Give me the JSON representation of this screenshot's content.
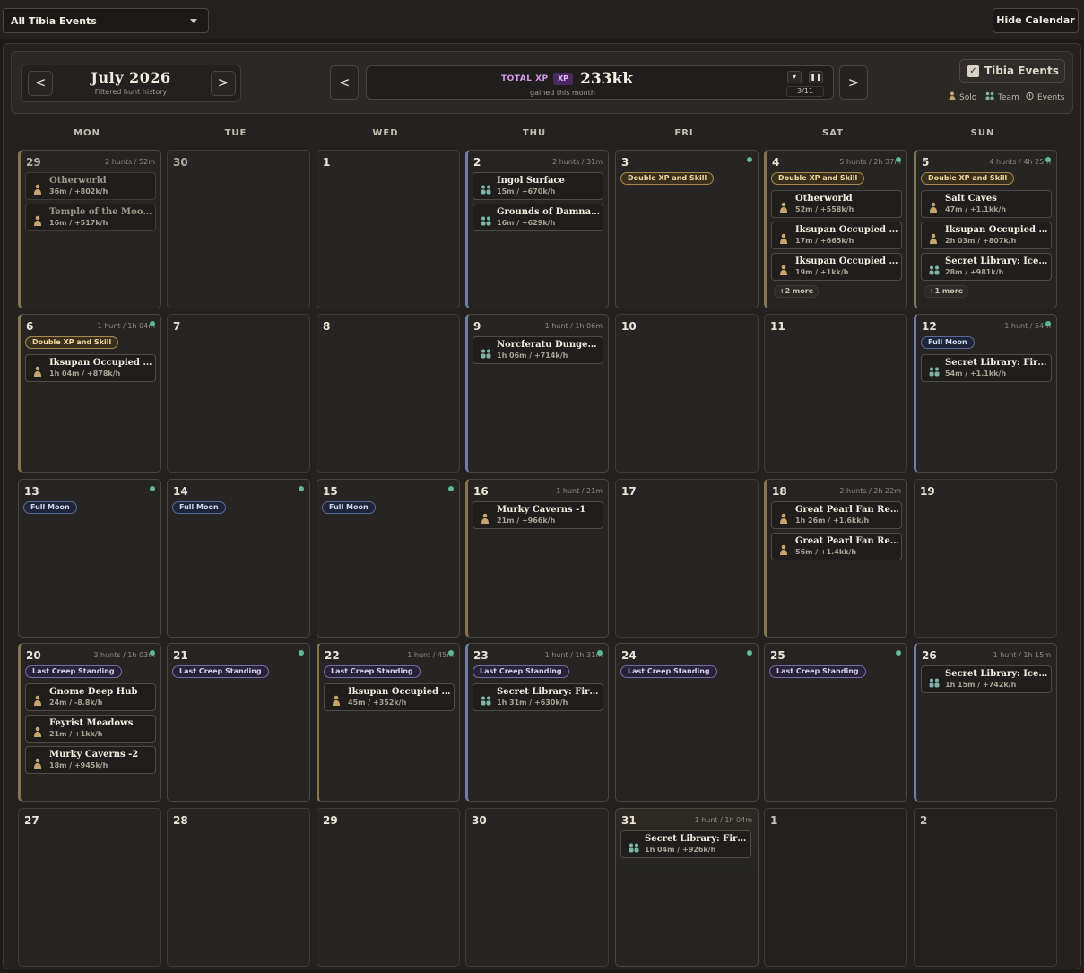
{
  "topbar": {
    "filter_value": "All Tibia Events",
    "hide_button": "Hide Calendar"
  },
  "header": {
    "prev": "<",
    "next": ">",
    "month_title": "July 2026",
    "month_subtitle": "Filtered hunt history",
    "big_prev": "<",
    "big_next": ">",
    "xp_label": "TOTAL XP",
    "xp_badge": "XP",
    "xp_value": "233kk",
    "xp_subtitle": "gained this month",
    "xp_counter": "3/11",
    "dropdown_glyph": "▾",
    "pause_glyph": "❚❚",
    "events_toggle": "Tibia Events",
    "check_glyph": "✓",
    "legend": {
      "solo": "Solo",
      "team": "Team",
      "events": "Events"
    }
  },
  "weekdays": [
    "MON",
    "TUE",
    "WED",
    "THU",
    "FRI",
    "SAT",
    "SUN"
  ],
  "colors": {
    "solo": "#c9a56a",
    "team": "#7fb5a8",
    "accent_dot": "#5fb89a",
    "xp_purple": "#d79ae8"
  },
  "days": [
    {
      "num": "29",
      "meta": "2 hunts / 52m",
      "muted": true,
      "bar": "solo",
      "hunts": [
        {
          "type": "solo",
          "name": "Otherworld",
          "stat": "36m / +802k/h"
        },
        {
          "type": "solo",
          "name": "Temple of the Moon Goddess",
          "stat": "16m / +517k/h"
        }
      ]
    },
    {
      "num": "30",
      "muted": true
    },
    {
      "num": "1"
    },
    {
      "num": "2",
      "meta": "2 hunts / 31m",
      "bar": "team",
      "hunts": [
        {
          "type": "team",
          "name": "Ingol Surface",
          "stat": "15m / +670k/h"
        },
        {
          "type": "team",
          "name": "Grounds of Damnation",
          "stat": "16m / +629k/h"
        }
      ]
    },
    {
      "num": "3",
      "dot": true,
      "event": {
        "kind": "dxp",
        "label": "Double XP and Skill"
      }
    },
    {
      "num": "4",
      "meta": "5 hunts / 2h 37m",
      "dot": true,
      "bar": "solo",
      "event": {
        "kind": "dxp",
        "label": "Double XP and Skill"
      },
      "hunts": [
        {
          "type": "solo",
          "name": "Otherworld",
          "stat": "52m / +558k/h"
        },
        {
          "type": "solo",
          "name": "Iksupan Occupied Area",
          "stat": "17m / +665k/h"
        },
        {
          "type": "solo",
          "name": "Iksupan Occupied Area",
          "stat": "19m / +1kk/h"
        }
      ],
      "more": "+2 more"
    },
    {
      "num": "5",
      "meta": "4 hunts / 4h 25m",
      "dot": true,
      "bar": "solo",
      "event": {
        "kind": "dxp",
        "label": "Double XP and Skill"
      },
      "hunts": [
        {
          "type": "solo",
          "name": "Salt Caves",
          "stat": "47m / +1.1kk/h"
        },
        {
          "type": "solo",
          "name": "Iksupan Occupied Area",
          "stat": "2h 03m / +807k/h"
        },
        {
          "type": "team",
          "name": "Secret Library: Ice Section",
          "stat": "28m / +981k/h"
        }
      ],
      "more": "+1 more"
    },
    {
      "num": "6",
      "meta": "1 hunt / 1h 04m",
      "dot": true,
      "bar": "solo",
      "event": {
        "kind": "dxp",
        "label": "Double XP and Skill"
      },
      "hunts": [
        {
          "type": "solo",
          "name": "Iksupan Occupied Area",
          "stat": "1h 04m / +878k/h"
        }
      ]
    },
    {
      "num": "7"
    },
    {
      "num": "8"
    },
    {
      "num": "9",
      "meta": "1 hunt / 1h 06m",
      "bar": "team",
      "hunts": [
        {
          "type": "team",
          "name": "Norcferatu Dungeons",
          "stat": "1h 06m / +714k/h"
        }
      ]
    },
    {
      "num": "10"
    },
    {
      "num": "11"
    },
    {
      "num": "12",
      "meta": "1 hunt / 54m",
      "dot": true,
      "bar": "team",
      "event": {
        "kind": "moon",
        "label": "Full Moon"
      },
      "hunts": [
        {
          "type": "team",
          "name": "Secret Library: Fire Section",
          "stat": "54m / +1.1kk/h"
        }
      ]
    },
    {
      "num": "13",
      "dot": true,
      "event": {
        "kind": "moon",
        "label": "Full Moon"
      }
    },
    {
      "num": "14",
      "dot": true,
      "event": {
        "kind": "moon",
        "label": "Full Moon"
      }
    },
    {
      "num": "15",
      "dot": true,
      "event": {
        "kind": "moon",
        "label": "Full Moon"
      }
    },
    {
      "num": "16",
      "meta": "1 hunt / 21m",
      "bar": "solo",
      "hunts": [
        {
          "type": "solo",
          "name": "Murky Caverns -1",
          "stat": "21m / +966k/h"
        }
      ]
    },
    {
      "num": "17"
    },
    {
      "num": "18",
      "meta": "2 hunts / 2h 22m",
      "bar": "solo",
      "hunts": [
        {
          "type": "solo",
          "name": "Great Pearl Fan Reef",
          "stat": "1h 26m / +1.6kk/h"
        },
        {
          "type": "solo",
          "name": "Great Pearl Fan Reef",
          "stat": "56m / +1.4kk/h"
        }
      ]
    },
    {
      "num": "19"
    },
    {
      "num": "20",
      "meta": "3 hunts / 1h 03m",
      "dot": true,
      "bar": "solo",
      "event": {
        "kind": "creep",
        "label": "Last Creep Standing"
      },
      "hunts": [
        {
          "type": "solo",
          "name": "Gnome Deep Hub",
          "stat": "24m / -8.8k/h"
        },
        {
          "type": "solo",
          "name": "Feyrist Meadows",
          "stat": "21m / +1kk/h"
        },
        {
          "type": "solo",
          "name": "Murky Caverns -2",
          "stat": "18m / +945k/h"
        }
      ]
    },
    {
      "num": "21",
      "dot": true,
      "event": {
        "kind": "creep",
        "label": "Last Creep Standing"
      }
    },
    {
      "num": "22",
      "meta": "1 hunt / 45m",
      "dot": true,
      "bar": "solo",
      "event": {
        "kind": "creep",
        "label": "Last Creep Standing"
      },
      "hunts": [
        {
          "type": "solo",
          "name": "Iksupan Occupied Area",
          "stat": "45m / +352k/h"
        }
      ]
    },
    {
      "num": "23",
      "meta": "1 hunt / 1h 31m",
      "dot": true,
      "bar": "team",
      "event": {
        "kind": "creep",
        "label": "Last Creep Standing"
      },
      "hunts": [
        {
          "type": "team",
          "name": "Secret Library: Fire Section",
          "stat": "1h 31m / +630k/h"
        }
      ]
    },
    {
      "num": "24",
      "dot": true,
      "event": {
        "kind": "creep",
        "label": "Last Creep Standing"
      }
    },
    {
      "num": "25",
      "dot": true,
      "event": {
        "kind": "creep",
        "label": "Last Creep Standing"
      }
    },
    {
      "num": "26",
      "meta": "1 hunt / 1h 15m",
      "bar": "team",
      "hunts": [
        {
          "type": "team",
          "name": "Secret Library: Ice Section",
          "stat": "1h 15m / +742k/h"
        }
      ]
    },
    {
      "num": "27"
    },
    {
      "num": "28"
    },
    {
      "num": "29"
    },
    {
      "num": "30"
    },
    {
      "num": "31",
      "meta": "1 hunt / 1h 04m",
      "glow": true,
      "hunts": [
        {
          "type": "team",
          "name": "Secret Library: Fire Section",
          "stat": "1h 04m / +926k/h"
        }
      ]
    },
    {
      "num": "1",
      "dim": true
    },
    {
      "num": "2",
      "dim": true
    }
  ]
}
